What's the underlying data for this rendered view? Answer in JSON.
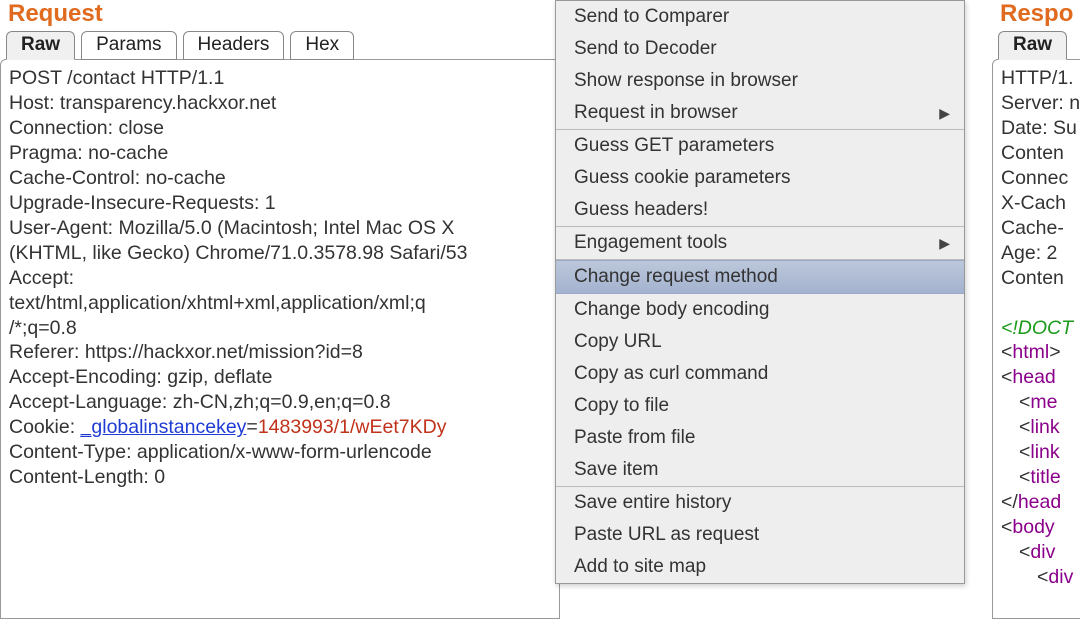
{
  "request": {
    "title": "Request",
    "tabs": [
      "Raw",
      "Params",
      "Headers",
      "Hex"
    ],
    "activeTab": 0,
    "lines": {
      "reqLine": "POST /contact HTTP/1.1",
      "host": "Host: transparency.hackxor.net",
      "conn": "Connection: close",
      "pragma": "Pragma: no-cache",
      "cache": "Cache-Control: no-cache",
      "upgrade": "Upgrade-Insecure-Requests: 1",
      "ua1": "User-Agent: Mozilla/5.0 (Macintosh; Intel Mac OS X",
      "ua2": "(KHTML, like Gecko) Chrome/71.0.3578.98 Safari/53",
      "acceptLabel": "Accept:",
      "accept1": "text/html,application/xhtml+xml,application/xml;q",
      "accept2": "/*;q=0.8",
      "referer": "Referer: https://hackxor.net/mission?id=8",
      "acceptEnc": "Accept-Encoding: gzip, deflate",
      "acceptLang": "Accept-Language: zh-CN,zh;q=0.9,en;q=0.8",
      "cookiePrefix": "Cookie: ",
      "cookieKey": "_globalinstancekey",
      "cookieEq": "=",
      "cookieVal": "1483993/1/wEet7KDy",
      "ctype": "Content-Type: application/x-www-form-urlencode",
      "clen": "Content-Length: 0"
    }
  },
  "response": {
    "title": "Respo",
    "tabs": [
      "Raw"
    ],
    "activeTab": 0,
    "headers": {
      "status": "HTTP/1.",
      "server": "Server: n",
      "date": "Date: Su",
      "ctype": "Conten",
      "conn": "Connec",
      "xcache": "X-Cach",
      "cache": "Cache-",
      "age": "Age: 2",
      "ctype2": "Conten"
    },
    "body": {
      "doctype": "<!DOCT",
      "htmlOpen": "html",
      "htmlTail": ">",
      "headOpen": "head",
      "meta": "me",
      "link1": "link",
      "link2": "link",
      "title": "title",
      "headClose": "head",
      "bodyOpen": "body",
      "div1": "div",
      "div2": "div"
    }
  },
  "menu": {
    "groups": [
      [
        {
          "label": "Send to Comparer",
          "sub": false
        },
        {
          "label": "Send to Decoder",
          "sub": false
        },
        {
          "label": "Show response in browser",
          "sub": false
        },
        {
          "label": "Request in browser",
          "sub": true
        }
      ],
      [
        {
          "label": "Guess GET parameters",
          "sub": false
        },
        {
          "label": "Guess cookie parameters",
          "sub": false
        },
        {
          "label": "Guess headers!",
          "sub": false
        }
      ],
      [
        {
          "label": "Engagement tools",
          "sub": true
        }
      ],
      [
        {
          "label": "Change request method",
          "sub": false,
          "hl": true
        },
        {
          "label": "Change body encoding",
          "sub": false
        },
        {
          "label": "Copy URL",
          "sub": false
        },
        {
          "label": "Copy as curl command",
          "sub": false
        },
        {
          "label": "Copy to file",
          "sub": false
        },
        {
          "label": "Paste from file",
          "sub": false
        },
        {
          "label": "Save item",
          "sub": false
        }
      ],
      [
        {
          "label": "Save entire history",
          "sub": false
        },
        {
          "label": "Paste URL as request",
          "sub": false
        },
        {
          "label": "Add to site map",
          "sub": false
        }
      ]
    ]
  }
}
